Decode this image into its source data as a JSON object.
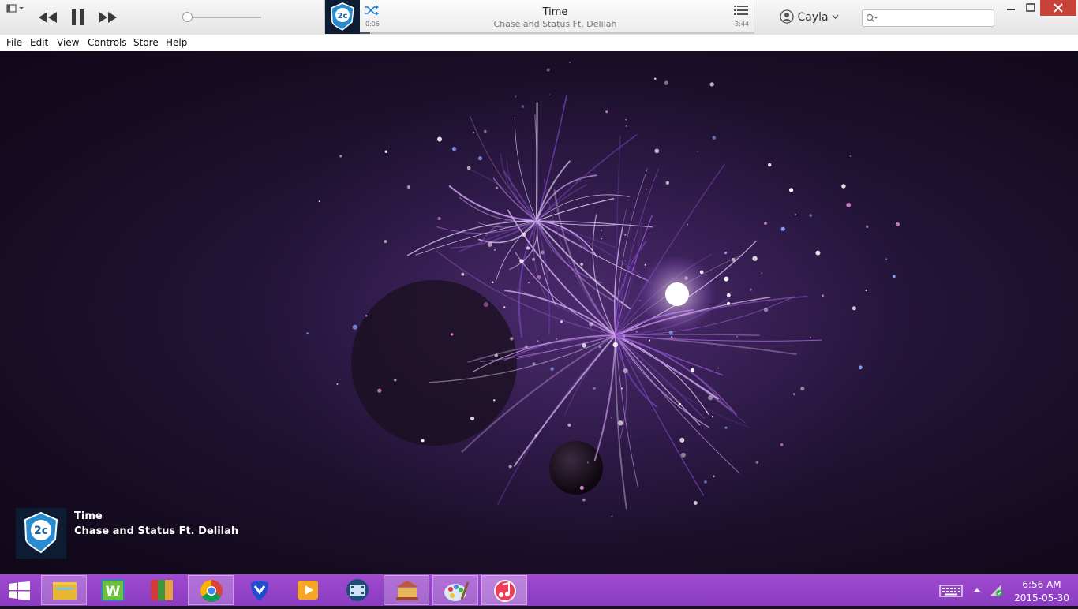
{
  "app": {
    "name": "iTunes",
    "accent": "#1f7ad6"
  },
  "player": {
    "track_title": "Time",
    "track_artist": "Chase and Status Ft. Delilah",
    "elapsed": "0:06",
    "remaining": "-3:44",
    "progress": 0.027,
    "volume": 0.0,
    "shuffle_icon": "shuffle-icon",
    "list_icon": "up-next-list-icon"
  },
  "account": {
    "name": "Cayla"
  },
  "search": {
    "placeholder": ""
  },
  "menu": {
    "items": [
      "File",
      "Edit",
      "View",
      "Controls",
      "Store",
      "Help"
    ]
  },
  "now_playing": {
    "title": "Time",
    "artist": "Chase and Status Ft. Delilah"
  },
  "album_art": {
    "logo_text": "2c"
  },
  "taskbar": {
    "color": "#9340c8",
    "apps": [
      "file-explorer-icon",
      "wunderlist-icon",
      "winrar-icon",
      "chrome-icon",
      "malwarebytes-icon",
      "video-player-icon",
      "movie-maker-icon",
      "library-icon",
      "paint-icon",
      "itunes-icon"
    ],
    "clock_time": "6:56 AM",
    "clock_date": "2015-05-30"
  }
}
